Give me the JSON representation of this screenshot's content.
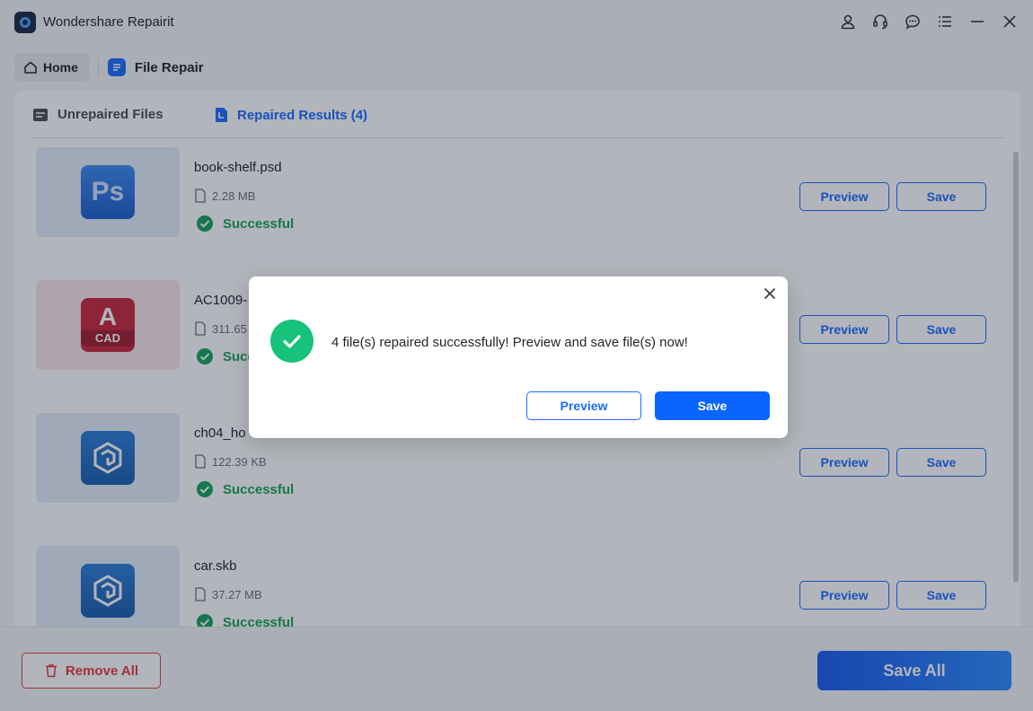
{
  "app": {
    "title": "Wondershare Repairit"
  },
  "breadcrumb": {
    "home_label": "Home",
    "current_label": "File Repair"
  },
  "tabs": [
    {
      "label": "Unrepaired Files",
      "active": false
    },
    {
      "label": "Repaired Results (4)",
      "active": true
    }
  ],
  "files": [
    {
      "name": "book-shelf.psd",
      "size": "2.28 MB",
      "status": "Successful",
      "icon": "photoshop-icon",
      "icon_text": "Ps"
    },
    {
      "name": "AC1009-",
      "size": "311.65",
      "status": "Succ",
      "icon": "autocad-icon",
      "icon_text": "A",
      "icon_subtext": "CAD"
    },
    {
      "name": "ch04_ho",
      "size": "122.39 KB",
      "status": "Successful",
      "icon": "sketchup-icon"
    },
    {
      "name": "car.skb",
      "size": "37.27 MB",
      "status": "Successful",
      "icon": "sketchup-icon"
    }
  ],
  "row_buttons": {
    "preview_label": "Preview",
    "save_label": "Save"
  },
  "footer": {
    "remove_all_label": "Remove All",
    "save_all_label": "Save All"
  },
  "dialog": {
    "message": "4 file(s) repaired successfully! Preview and save file(s) now!",
    "preview_label": "Preview",
    "save_label": "Save"
  },
  "colors": {
    "accent": "#1b6cff",
    "success": "#17a35a",
    "danger": "#e23c3c",
    "dialog_check": "#17c27a"
  }
}
